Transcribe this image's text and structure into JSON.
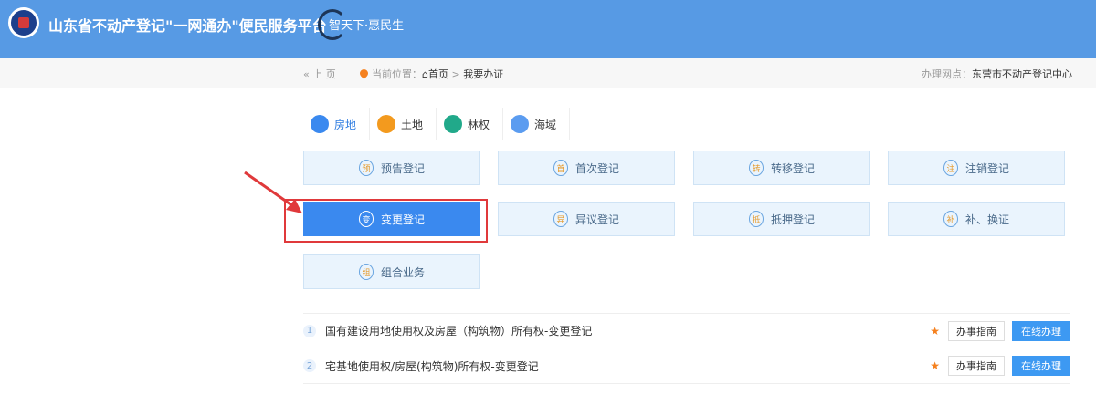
{
  "header": {
    "title": "山东省不动产登记\"一网通办\"便民服务平台",
    "slogan": "智天下·惠民生"
  },
  "breadcrumb": {
    "back": "« 上 页",
    "location_label": "当前位置：",
    "home": "首页",
    "separator": ">",
    "current": "我要办证",
    "network_label": "办理网点：",
    "network_value": "东营市不动产登记中心"
  },
  "tabs": [
    {
      "label": "房地",
      "color": "#3a89ef",
      "active": true
    },
    {
      "label": "土地",
      "color": "#f39a1e"
    },
    {
      "label": "林权",
      "color": "#21a98a"
    },
    {
      "label": "海域",
      "color": "#5b9cf0"
    }
  ],
  "buttons": [
    {
      "icon": "预",
      "label": "预告登记"
    },
    {
      "icon": "首",
      "label": "首次登记"
    },
    {
      "icon": "转",
      "label": "转移登记"
    },
    {
      "icon": "注",
      "label": "注销登记"
    },
    {
      "icon": "变",
      "label": "变更登记",
      "selected": true
    },
    {
      "icon": "异",
      "label": "异议登记"
    },
    {
      "icon": "抵",
      "label": "抵押登记"
    },
    {
      "icon": "补",
      "label": "补、换证"
    },
    {
      "icon": "组",
      "label": "组合业务"
    }
  ],
  "list": [
    {
      "num": "1",
      "title": "国有建设用地使用权及房屋（构筑物）所有权-变更登记",
      "star": "★",
      "guide": "办事指南",
      "online": "在线办理"
    },
    {
      "num": "2",
      "title": "宅基地使用权/房屋(构筑物)所有权-变更登记",
      "star": "★",
      "guide": "办事指南",
      "online": "在线办理"
    }
  ]
}
